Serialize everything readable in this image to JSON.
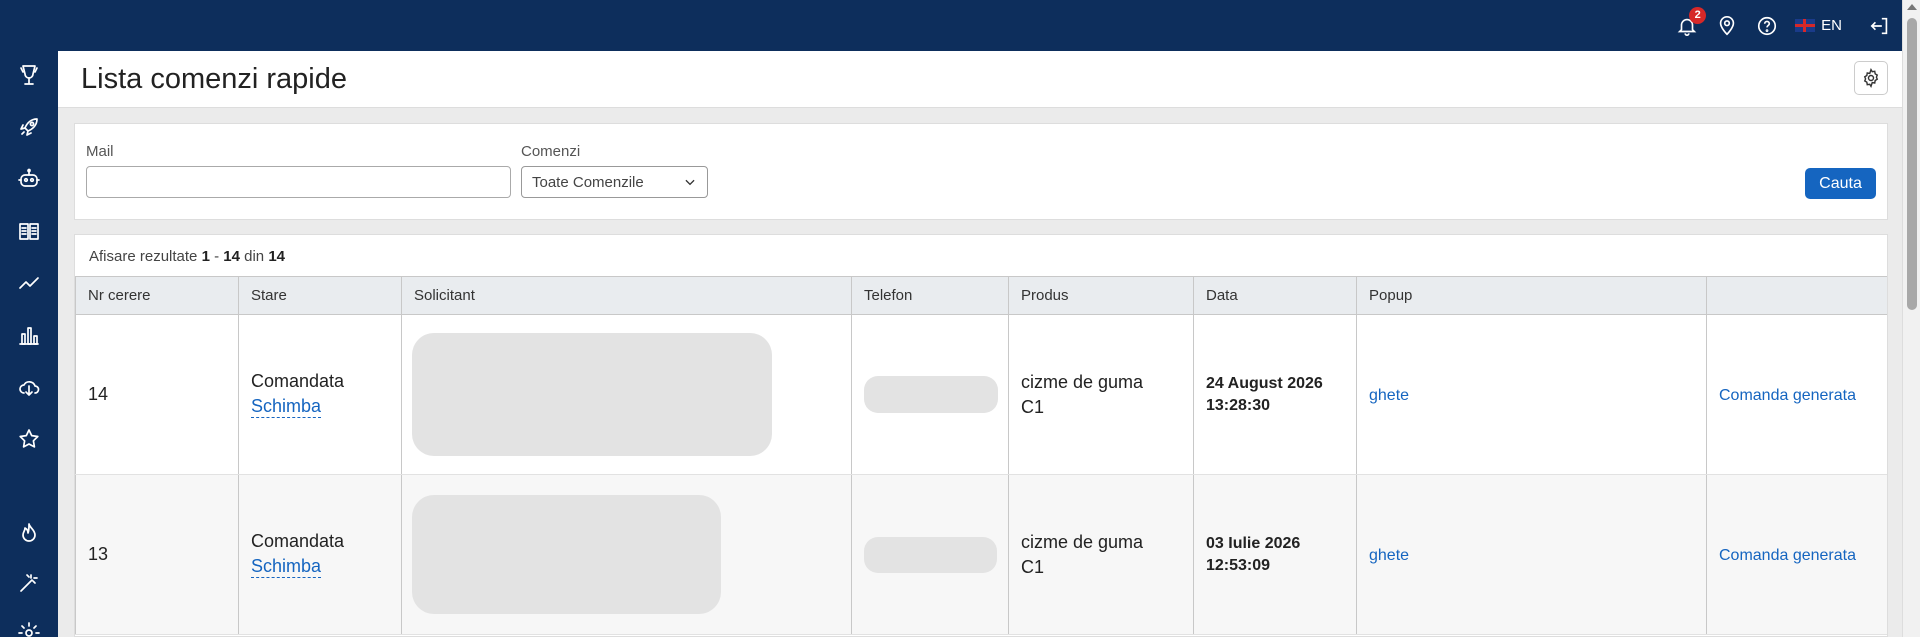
{
  "topbar": {
    "notifications_count": "2",
    "language": "EN"
  },
  "sidebar": {
    "items": [
      {
        "icon": "trophy-icon"
      },
      {
        "icon": "rocket-icon"
      },
      {
        "icon": "robot-icon"
      },
      {
        "icon": "book-icon"
      },
      {
        "icon": "trend-line-icon"
      },
      {
        "icon": "bar-chart-icon"
      },
      {
        "icon": "cloud-download-icon"
      },
      {
        "icon": "star-icon"
      },
      {
        "icon": "flame-icon"
      },
      {
        "icon": "magic-wand-icon"
      },
      {
        "icon": "settings-icon"
      }
    ]
  },
  "page": {
    "title": "Lista comenzi rapide"
  },
  "filters": {
    "mail_label": "Mail",
    "mail_value": "",
    "orders_label": "Comenzi",
    "orders_selected": "Toate Comenzile",
    "search_button": "Cauta"
  },
  "results": {
    "summary_prefix": "Afisare rezultate",
    "range_start": "1",
    "range_sep": "-",
    "range_end": "14",
    "of_word": "din",
    "total": "14"
  },
  "table": {
    "columns": [
      "Nr cerere",
      "Stare",
      "Solicitant",
      "Telefon",
      "Produs",
      "Data",
      "Popup",
      ""
    ],
    "rows": [
      {
        "id": "14",
        "state": "Comandata",
        "change_link": "Schimba",
        "product_line1": "cizme de guma",
        "product_line2": "C1",
        "date_line1": "24 August 2026",
        "date_line2": "13:28:30",
        "popup": "ghete",
        "action": "Comanda generata"
      },
      {
        "id": "13",
        "state": "Comandata",
        "change_link": "Schimba",
        "product_line1": "cizme de guma",
        "product_line2": "C1",
        "date_line1": "03 Iulie 2026",
        "date_line2": "12:53:09",
        "popup": "ghete",
        "action": "Comanda generata"
      }
    ]
  },
  "colors": {
    "navy": "#0d2e5c",
    "accent_blue": "#1565c0",
    "badge_red": "#d62828"
  }
}
